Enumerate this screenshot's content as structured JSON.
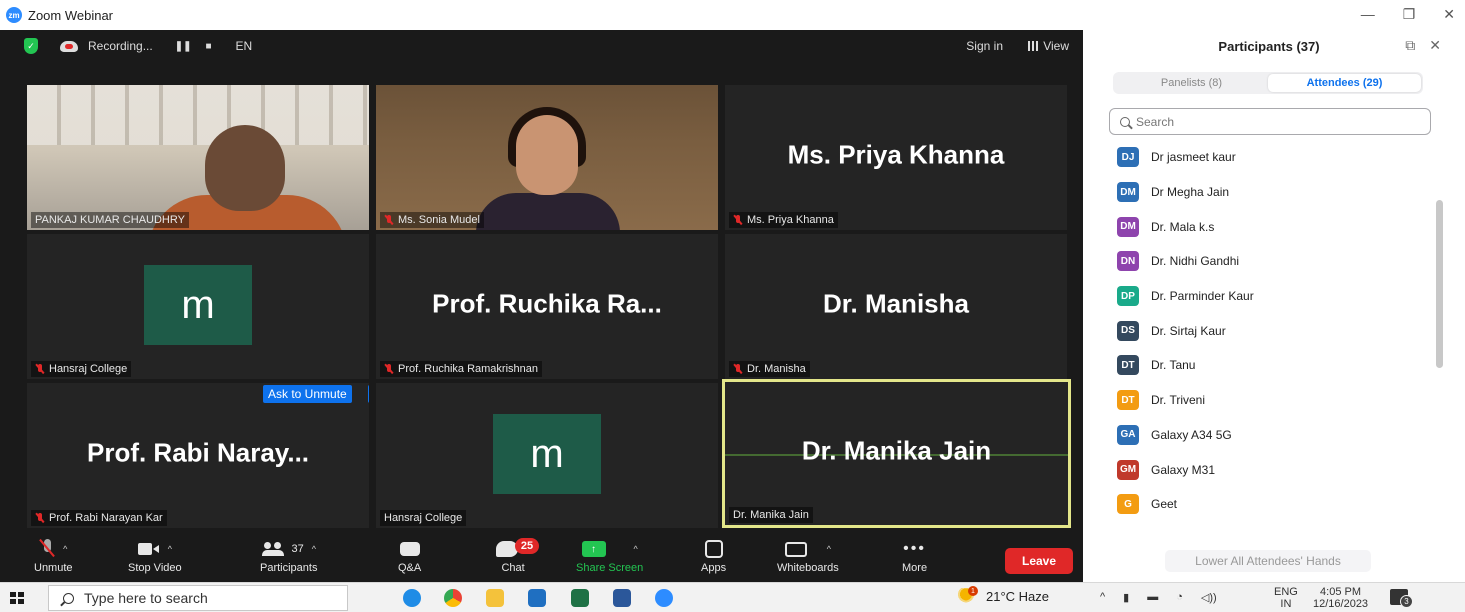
{
  "window": {
    "title": "Zoom Webinar",
    "logo_text": "zm"
  },
  "topbar": {
    "recording_label": "Recording...",
    "pause_label": "❚❚",
    "stop_label": "■",
    "language": "EN",
    "sign_in": "Sign in",
    "view": "View"
  },
  "tiles": {
    "pankaj": {
      "name": "PANKAJ KUMAR CHAUDHRY"
    },
    "sonia": {
      "name": "Ms. Sonia Mudel"
    },
    "priya": {
      "display": "Ms. Priya Khanna",
      "name": "Ms. Priya Khanna"
    },
    "hansraj1": {
      "avatar": "m",
      "name": "Hansraj College"
    },
    "ruchika": {
      "display": "Prof. Ruchika Ra...",
      "name": "Prof. Ruchika Ramakrishnan"
    },
    "manisha": {
      "display": "Dr. Manisha",
      "name": "Dr. Manisha"
    },
    "rabi": {
      "display": "Prof. Rabi Naray...",
      "name": "Prof. Rabi Narayan Kar",
      "ask_unmute": "Ask to Unmute",
      "more": "···"
    },
    "hansraj2": {
      "avatar": "m",
      "name": "Hansraj College"
    },
    "manika": {
      "display": "Dr. Manika Jain",
      "name": "Dr. Manika Jain"
    }
  },
  "toolbar": {
    "unmute": "Unmute",
    "stop_video": "Stop Video",
    "participants": "Participants",
    "participants_count": "37",
    "qa": "Q&A",
    "chat": "Chat",
    "chat_badge": "25",
    "share_screen": "Share Screen",
    "apps": "Apps",
    "whiteboards": "Whiteboards",
    "more": "More",
    "more_dots": "•••",
    "leave": "Leave"
  },
  "panel": {
    "title": "Participants (37)",
    "tab_panelists": "Panelists (8)",
    "tab_attendees": "Attendees (29)",
    "search_placeholder": "Search",
    "attendees": [
      {
        "initials": "DJ",
        "name": "Dr jasmeet kaur",
        "color": "#2d6fb5"
      },
      {
        "initials": "DM",
        "name": "Dr Megha Jain",
        "color": "#2d6fb5"
      },
      {
        "initials": "DM",
        "name": "Dr. Mala k.s",
        "color": "#8e44ad"
      },
      {
        "initials": "DN",
        "name": "Dr. Nidhi Gandhi",
        "color": "#8e44ad"
      },
      {
        "initials": "DP",
        "name": "Dr. Parminder Kaur",
        "color": "#1aaa8a"
      },
      {
        "initials": "DS",
        "name": "Dr. Sirtaj Kaur",
        "color": "#34495e"
      },
      {
        "initials": "DT",
        "name": "Dr. Tanu",
        "color": "#34495e"
      },
      {
        "initials": "DT",
        "name": "Dr. Triveni",
        "color": "#f39c12"
      },
      {
        "initials": "GA",
        "name": "Galaxy A34 5G",
        "color": "#2d6fb5"
      },
      {
        "initials": "GM",
        "name": "Galaxy M31",
        "color": "#c0392b"
      },
      {
        "initials": "G",
        "name": "Geet",
        "color": "#f39c12"
      }
    ],
    "lower_hands": "Lower All Attendees' Hands"
  },
  "taskbar": {
    "search_placeholder": "Type here to search",
    "weather": "21°C Haze",
    "weather_badge": "1",
    "lang_top": "ENG",
    "lang_bottom": "IN",
    "time": "4:05 PM",
    "date": "12/16/2023",
    "notif_count": "3"
  }
}
